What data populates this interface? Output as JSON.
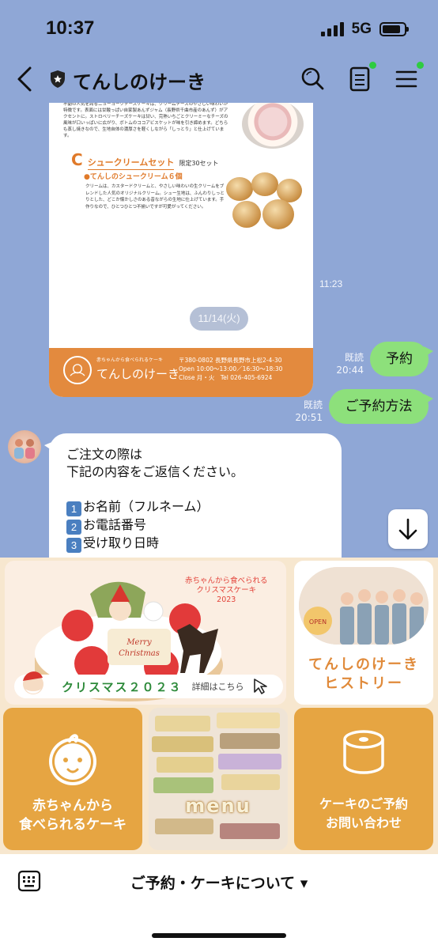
{
  "status_bar": {
    "time": "10:37",
    "network": "5G",
    "battery_level_percent": 85
  },
  "header": {
    "title": "てんしのけーき",
    "icons": [
      "back-icon",
      "shield-icon",
      "search-icon",
      "notes-icon",
      "menu-icon"
    ]
  },
  "flyer": {
    "intro_text": "不動の人気を誇るニューヨークチーズケーキは、クリームチーズのやさしい味わいが特徴です。表面には甘酸っぱい自家製あんずジャム（長野県千曲市産のあんず）がアクセントに。ストロベリーチーズケーキは甘い、完熟いちごとクリーミーなチーズの風味が口いっぱいに広がり、ボトムのココアビスケットが味を引き締めます。どちらも蒸し焼きなので、生地自体の濃厚さを軽くしながら「しっとり」と仕上げています。",
    "section_letter": "C",
    "section_title": "シュークリームセット",
    "section_limit": "限定30セット",
    "sub_heading": "●てんしのシュークリーム６個",
    "description": "クリームは、カスタードクリームと、やさしい味わいの生クリームをブレンドした人気のオリジナルクリーム。シュー生地は、ふんわりしっとりとした、どこか懐かしさのある昔ながらの生地に仕上げています。手作りなので、ひとつひとつ不揃いですが可愛がってください。",
    "logo_sub": "赤ちゃんから食べられるケーキ",
    "logo_name": "てんしのけーき",
    "address": "〒380-0802 長野県長野市上松2-4-30",
    "hours": "Open 10:00～13:00／16:30～18:30",
    "closed_tel": "Close 月・火　Tel 026-405-6924"
  },
  "messages": {
    "flyer_time": "11:23",
    "date_label": "11/14(火)",
    "reservation": {
      "text": "予約",
      "read": "既読",
      "time": "20:44"
    },
    "how_to_reserve": {
      "text": "ご予約方法",
      "read": "既読",
      "time": "20:51"
    },
    "reply": {
      "line1": "ご注文の際は",
      "line2": "下記の内容をご返信ください。",
      "items": [
        {
          "num": "1",
          "text": "お名前（フルネーム）"
        },
        {
          "num": "2",
          "text": "お電話番号"
        },
        {
          "num": "3",
          "text": "受け取り日時"
        }
      ]
    }
  },
  "rich_menu": {
    "xmas": {
      "caption_line1": "赤ちゃんから食べられる",
      "caption_line2": "クリスマスケーキ",
      "caption_year": "2023",
      "plaque_line1": "Merry",
      "plaque_line2": "Christmas",
      "label": "クリスマス２０２３",
      "link": "詳細はこちら"
    },
    "history": {
      "sign": "OPEN",
      "line1": "てんしのけーき",
      "line2": "ヒストリー"
    },
    "baby": {
      "line1": "赤ちゃんから",
      "line2": "食べられるケーキ"
    },
    "menu": {
      "label": "menu"
    },
    "contact": {
      "line1": "ケーキのご予約",
      "line2": "お問い合わせ"
    }
  },
  "bottom_bar": {
    "label": "ご予約・ケーキについて ▾"
  },
  "colors": {
    "chat_background": "#8fa7d6",
    "sent_bubble": "#8de07b",
    "accent_orange": "#e38a3e",
    "rich_menu_tile": "#e6a542"
  }
}
